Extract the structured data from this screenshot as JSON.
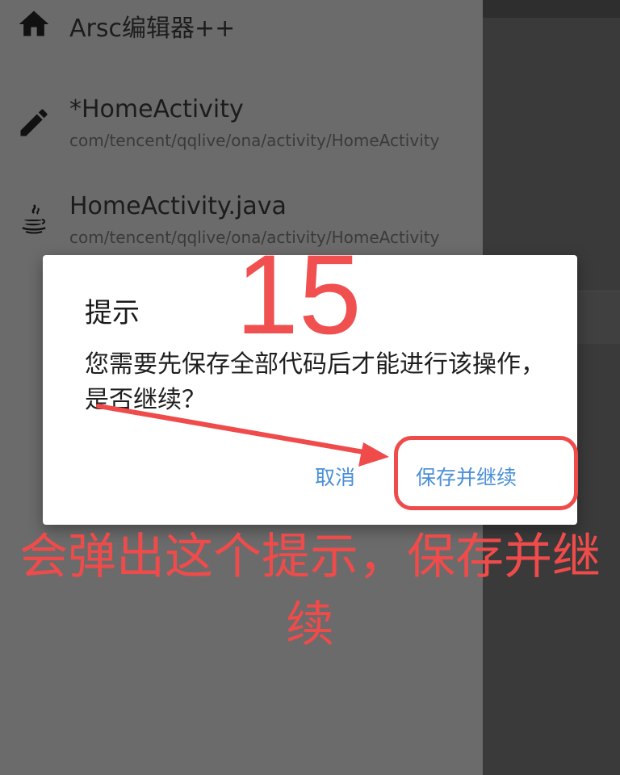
{
  "drawer": {
    "items": [
      {
        "icon": "home-icon",
        "title": "Arsc编辑器++"
      },
      {
        "icon": "pencil-icon",
        "title": "*HomeActivity",
        "subtitle": "com/tencent/qqlive/ona/activity/HomeActivity"
      },
      {
        "icon": "java-icon",
        "title": "HomeActivity.java",
        "subtitle": "com/tencent/qqlive/ona/activity/HomeActivity"
      }
    ]
  },
  "dialog": {
    "title": "提示",
    "message": "您需要先保存全部代码后才能进行该操作，是否继续？",
    "cancel_label": "取消",
    "confirm_label": "保存并继续"
  },
  "annotation": {
    "step_number": "15",
    "note": "会弹出这个提示，保存并继续",
    "color": "#f04b4b"
  },
  "colors": {
    "drawer_bg": "#6b6b6b",
    "dialog_button": "#4a90d6"
  }
}
